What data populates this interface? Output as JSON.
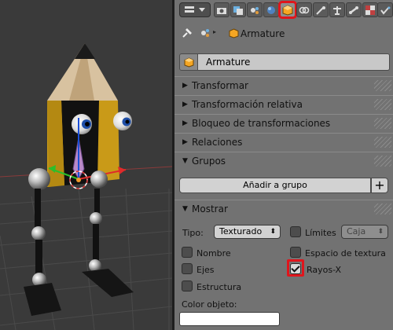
{
  "properties": {
    "breadcrumb": {
      "object": "Armature"
    },
    "object_name": "Armature",
    "sections": [
      {
        "label": "Transformar",
        "expanded": false
      },
      {
        "label": "Transformación relativa",
        "expanded": false
      },
      {
        "label": "Bloqueo de transformaciones",
        "expanded": false
      },
      {
        "label": "Relaciones",
        "expanded": false
      },
      {
        "label": "Grupos",
        "expanded": true
      },
      {
        "label": "Mostrar",
        "expanded": true
      }
    ],
    "groups": {
      "add_button": "Añadir a grupo",
      "plus": "+"
    },
    "display": {
      "tipo_label": "Tipo:",
      "tipo_value": "Texturado",
      "limites_label": "Límites",
      "limites_value": "Caja",
      "nombre": "Nombre",
      "espacio_textura": "Espacio de textura",
      "ejes": "Ejes",
      "rayos_x": "Rayos-X",
      "estructura": "Estructura",
      "color_label": "Color objeto:",
      "checked": {
        "limites": false,
        "nombre": false,
        "espacio_textura": false,
        "ejes": false,
        "rayos_x": true,
        "estructura": false
      }
    }
  },
  "icons": {
    "tabs": [
      "render-icon",
      "render-layers-icon",
      "scene-icon",
      "world-icon",
      "object-icon",
      "constraints-icon",
      "modifiers-icon",
      "data-icon",
      "bone-icon",
      "texture-icon",
      "particles-icon"
    ],
    "crumb": [
      "pin-icon",
      "scene-icon",
      "object-icon"
    ]
  },
  "colors": {
    "highlight": "#e0151c",
    "panel_bg": "#727272",
    "object_icon": "#f5a623"
  }
}
